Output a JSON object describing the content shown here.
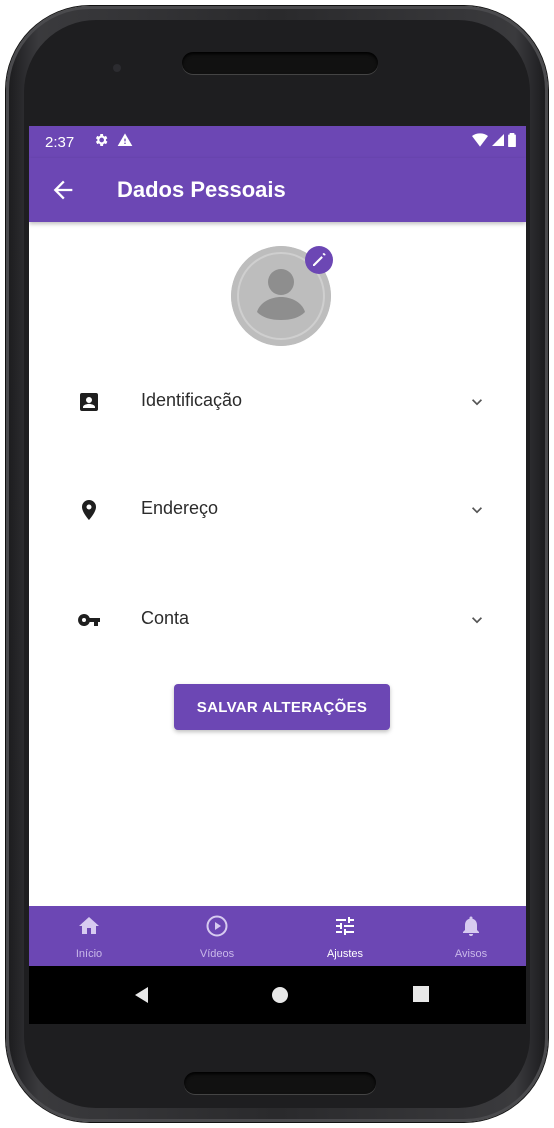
{
  "status_bar": {
    "time": "2:37"
  },
  "app_bar": {
    "title": "Dados Pessoais"
  },
  "sections": [
    {
      "label": "Identificação",
      "icon": "badge-icon"
    },
    {
      "label": "Endereço",
      "icon": "location-pin-icon"
    },
    {
      "label": "Conta",
      "icon": "key-icon"
    }
  ],
  "save_button": {
    "label": "SALVAR ALTERAÇÕES"
  },
  "bottom_nav": {
    "items": [
      {
        "label": "Início",
        "icon": "home-icon"
      },
      {
        "label": "Vídeos",
        "icon": "play-circle-icon"
      },
      {
        "label": "Ajustes",
        "icon": "sliders-icon",
        "active": true
      },
      {
        "label": "Avisos",
        "icon": "bell-icon"
      }
    ]
  },
  "colors": {
    "primary": "#6c47b4",
    "avatar_gray": "#bdbdbd",
    "avatar_dark": "#8e8e8e"
  }
}
